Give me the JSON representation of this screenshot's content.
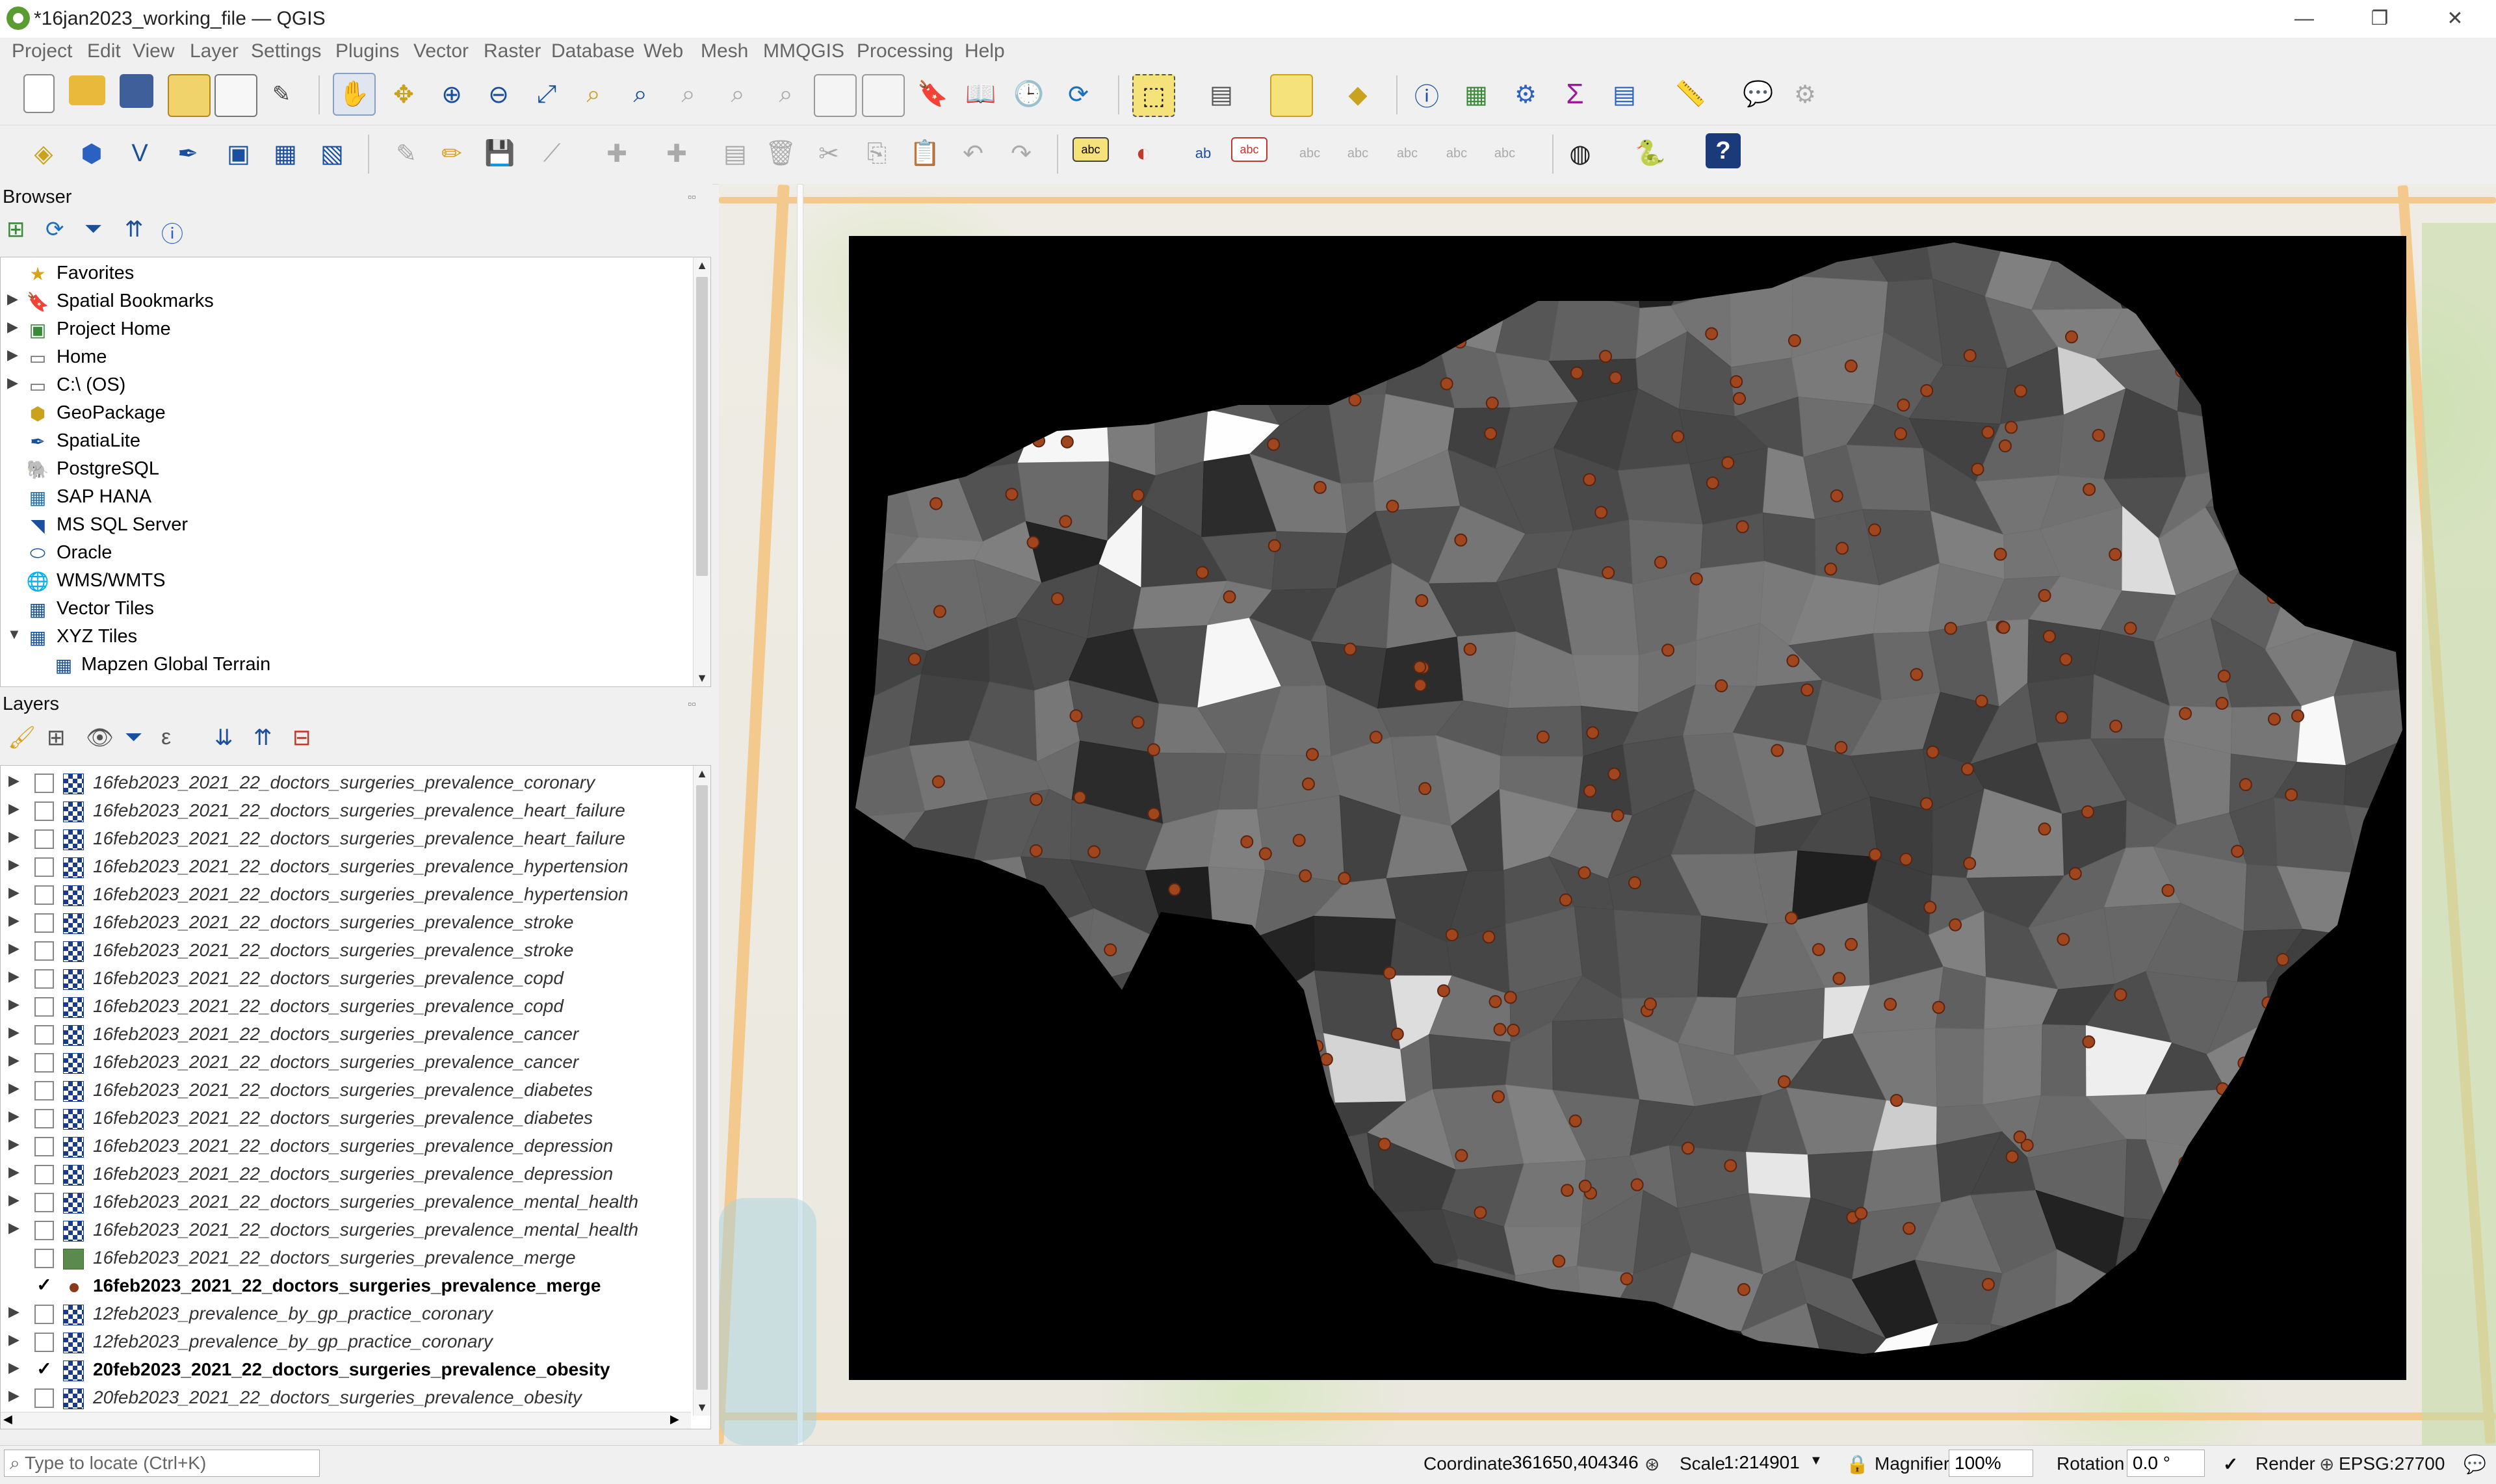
{
  "window": {
    "title": "*16jan2023_working_file — QGIS",
    "minimize": "—",
    "maximize": "❐",
    "close": "✕"
  },
  "menubar": [
    "Project",
    "Edit",
    "View",
    "Layer",
    "Settings",
    "Plugins",
    "Vector",
    "Raster",
    "Database",
    "Web",
    "Mesh",
    "MMQGIS",
    "Processing",
    "Help"
  ],
  "browser": {
    "title": "Browser",
    "items": [
      {
        "label": "Favorites",
        "icon": "star-icon",
        "expandable": false
      },
      {
        "label": "Spatial Bookmarks",
        "icon": "bookmark-icon",
        "expandable": true
      },
      {
        "label": "Project Home",
        "icon": "project-home-icon",
        "expandable": true
      },
      {
        "label": "Home",
        "icon": "folder-icon",
        "expandable": true
      },
      {
        "label": "C:\\ (OS)",
        "icon": "drive-icon",
        "expandable": true
      },
      {
        "label": "GeoPackage",
        "icon": "geopackage-icon",
        "expandable": false
      },
      {
        "label": "SpatiaLite",
        "icon": "spatialite-icon",
        "expandable": false
      },
      {
        "label": "PostgreSQL",
        "icon": "postgresql-icon",
        "expandable": false
      },
      {
        "label": "SAP HANA",
        "icon": "sap-hana-icon",
        "expandable": false
      },
      {
        "label": "MS SQL Server",
        "icon": "mssql-icon",
        "expandable": false
      },
      {
        "label": "Oracle",
        "icon": "oracle-icon",
        "expandable": false
      },
      {
        "label": "WMS/WMTS",
        "icon": "wms-icon",
        "expandable": false
      },
      {
        "label": "Vector Tiles",
        "icon": "vector-tiles-icon",
        "expandable": false
      },
      {
        "label": "XYZ Tiles",
        "icon": "xyz-tiles-icon",
        "expandable": true,
        "expanded": true
      },
      {
        "label": "Mapzen Global Terrain",
        "icon": "xyz-tiles-icon",
        "expandable": false,
        "child": true
      }
    ]
  },
  "layers": {
    "title": "Layers",
    "items": [
      {
        "label": "16feb2023_2021_22_doctors_surgeries_prevalence_coronary",
        "type": "raster",
        "checked": false,
        "active": false
      },
      {
        "label": "16feb2023_2021_22_doctors_surgeries_prevalence_heart_failure",
        "type": "raster",
        "checked": false,
        "active": false
      },
      {
        "label": "16feb2023_2021_22_doctors_surgeries_prevalence_heart_failure",
        "type": "raster",
        "checked": false,
        "active": false
      },
      {
        "label": "16feb2023_2021_22_doctors_surgeries_prevalence_hypertension",
        "type": "raster",
        "checked": false,
        "active": false
      },
      {
        "label": "16feb2023_2021_22_doctors_surgeries_prevalence_hypertension",
        "type": "raster",
        "checked": false,
        "active": false
      },
      {
        "label": "16feb2023_2021_22_doctors_surgeries_prevalence_stroke",
        "type": "raster",
        "checked": false,
        "active": false
      },
      {
        "label": "16feb2023_2021_22_doctors_surgeries_prevalence_stroke",
        "type": "raster",
        "checked": false,
        "active": false
      },
      {
        "label": "16feb2023_2021_22_doctors_surgeries_prevalence_copd",
        "type": "raster",
        "checked": false,
        "active": false
      },
      {
        "label": "16feb2023_2021_22_doctors_surgeries_prevalence_copd",
        "type": "raster",
        "checked": false,
        "active": false
      },
      {
        "label": "16feb2023_2021_22_doctors_surgeries_prevalence_cancer",
        "type": "raster",
        "checked": false,
        "active": false
      },
      {
        "label": "16feb2023_2021_22_doctors_surgeries_prevalence_cancer",
        "type": "raster",
        "checked": false,
        "active": false
      },
      {
        "label": "16feb2023_2021_22_doctors_surgeries_prevalence_diabetes",
        "type": "raster",
        "checked": false,
        "active": false
      },
      {
        "label": "16feb2023_2021_22_doctors_surgeries_prevalence_diabetes",
        "type": "raster",
        "checked": false,
        "active": false
      },
      {
        "label": "16feb2023_2021_22_doctors_surgeries_prevalence_depression",
        "type": "raster",
        "checked": false,
        "active": false
      },
      {
        "label": "16feb2023_2021_22_doctors_surgeries_prevalence_depression",
        "type": "raster",
        "checked": false,
        "active": false
      },
      {
        "label": "16feb2023_2021_22_doctors_surgeries_prevalence_mental_health",
        "type": "raster",
        "checked": false,
        "active": false
      },
      {
        "label": "16feb2023_2021_22_doctors_surgeries_prevalence_mental_health",
        "type": "raster",
        "checked": false,
        "active": false
      },
      {
        "label": "16feb2023_2021_22_doctors_surgeries_prevalence_merge",
        "type": "polygon",
        "checked": false,
        "active": false
      },
      {
        "label": "16feb2023_2021_22_doctors_surgeries_prevalence_merge",
        "type": "point",
        "checked": true,
        "active": true
      },
      {
        "label": "12feb2023_prevalence_by_gp_practice_coronary",
        "type": "raster",
        "checked": false,
        "active": false
      },
      {
        "label": "12feb2023_prevalence_by_gp_practice_coronary",
        "type": "raster",
        "checked": false,
        "active": false
      },
      {
        "label": "20feb2023_2021_22_doctors_surgeries_prevalence_obesity",
        "type": "raster",
        "checked": true,
        "active": true
      },
      {
        "label": "20feb2023_2021_22_doctors_surgeries_prevalence_obesity",
        "type": "raster",
        "checked": false,
        "active": false
      }
    ]
  },
  "statusbar": {
    "locate_placeholder": "Type to locate (Ctrl+K)",
    "coordinate_label": "Coordinate",
    "coordinate_value": "361650,404346",
    "scale_label": "Scale",
    "scale_value": "1:214901",
    "magnifier_label": "Magnifier",
    "magnifier_value": "100%",
    "rotation_label": "Rotation",
    "rotation_value": "0.0 °",
    "render_label": "Render",
    "crs": "EPSG:27700"
  },
  "map": {
    "raster_colors": {
      "background": "#000000",
      "light": "#ffffff",
      "dark": "#222222"
    },
    "point_color": "#a0461e"
  }
}
